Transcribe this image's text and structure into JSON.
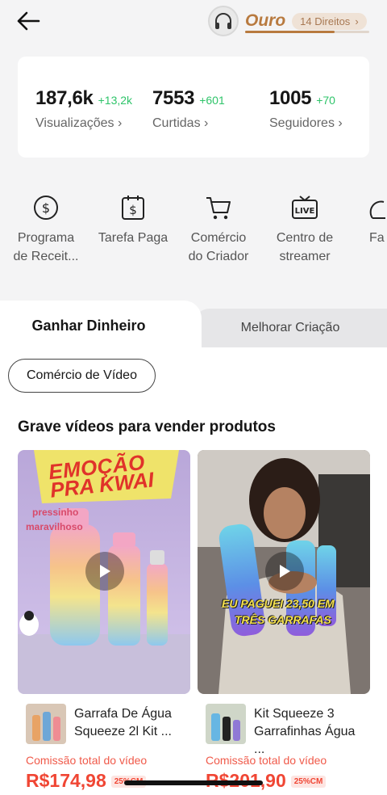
{
  "header": {
    "back_icon": "arrow-left-icon",
    "level_title": "Ouro",
    "level_pill": "14 Direitos",
    "level_progress": 0.72
  },
  "stats": [
    {
      "value": "187,6k",
      "delta": "+13,2k",
      "label": "Visualizações ›"
    },
    {
      "value": "7553",
      "delta": "+601",
      "label": "Curtidas ›"
    },
    {
      "value": "1005",
      "delta": "+70",
      "label": "Seguidores ›"
    }
  ],
  "tools": [
    {
      "label_line1": "Programa",
      "label_line2": "de Receit...",
      "icon": "dollar-circle-icon"
    },
    {
      "label_line1": "Tarefa Paga",
      "label_line2": "",
      "icon": "dollar-clipboard-icon"
    },
    {
      "label_line1": "Comércio",
      "label_line2": "do Criador",
      "icon": "cart-icon"
    },
    {
      "label_line1": "Centro de",
      "label_line2": "streamer",
      "icon": "live-tv-icon"
    },
    {
      "label_line1": "Fa",
      "label_line2": "",
      "icon": "more-icon"
    }
  ],
  "tabs": {
    "active": "Ganhar Dinheiro",
    "inactive": "Melhorar Criação"
  },
  "chip": "Comércio de Vídeo",
  "section_title": "Grave vídeos para vender produtos",
  "cards": [
    {
      "thumb_text_1": "EMOÇÃO",
      "thumb_text_2": "PRA KWAI",
      "thumb_text_3": "pressinho",
      "thumb_text_4": "maravilhoso",
      "product_name": "Garrafa De Água Squeeze 2l Kit ...",
      "commission_label": "Comissão total do vídeo",
      "price": "R$174,98",
      "badge": "25%CM"
    },
    {
      "thumb_text_1": "EU PAGUEI 23,50 EM",
      "thumb_text_2": "TRÊS GARRAFAS",
      "product_name": "Kit Squeeze 3 Garrafinhas Água ...",
      "commission_label": "Comissão total do vídeo",
      "price": "R$201,90",
      "badge": "25%CM"
    }
  ],
  "colors": {
    "accent_gold": "#b87a3f",
    "green": "#2fc46a",
    "price_red": "#f04634"
  }
}
